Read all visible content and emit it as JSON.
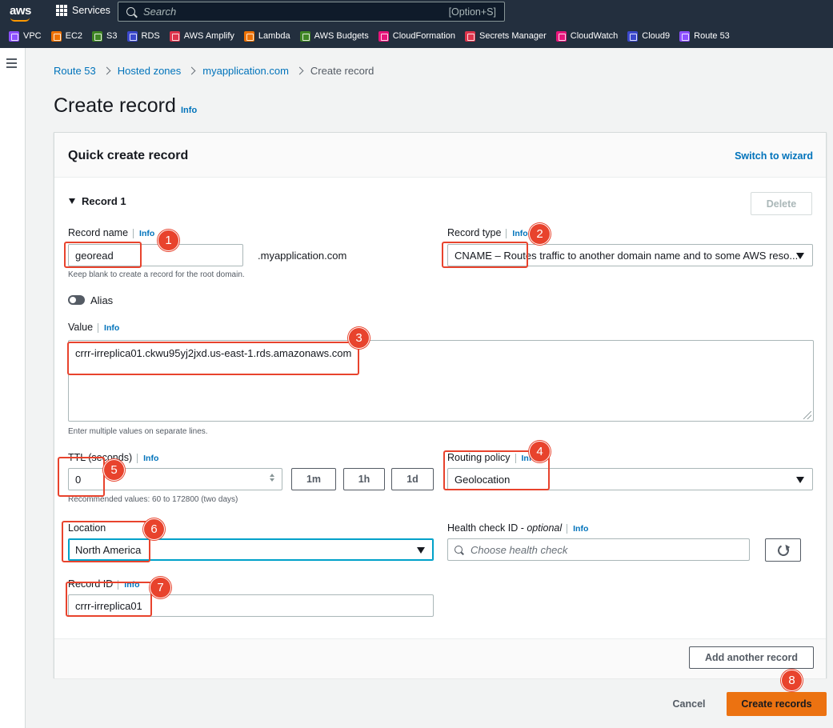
{
  "topnav": {
    "logo": "aws",
    "services_label": "Services",
    "search_placeholder": "Search",
    "search_shortcut": "[Option+S]",
    "favorites": [
      {
        "label": "VPC",
        "color": "#8c4fff"
      },
      {
        "label": "EC2",
        "color": "#ed7100"
      },
      {
        "label": "S3",
        "color": "#3f8624"
      },
      {
        "label": "RDS",
        "color": "#3b48cc"
      },
      {
        "label": "AWS Amplify",
        "color": "#dd344c"
      },
      {
        "label": "Lambda",
        "color": "#ed7100"
      },
      {
        "label": "AWS Budgets",
        "color": "#3f8624"
      },
      {
        "label": "CloudFormation",
        "color": "#e7157b"
      },
      {
        "label": "Secrets Manager",
        "color": "#dd344c"
      },
      {
        "label": "CloudWatch",
        "color": "#e7157b"
      },
      {
        "label": "Cloud9",
        "color": "#3b48cc"
      },
      {
        "label": "Route 53",
        "color": "#8c4fff"
      }
    ]
  },
  "breadcrumb": [
    "Route 53",
    "Hosted zones",
    "myapplication.com",
    "Create record"
  ],
  "page": {
    "title": "Create record",
    "info": "Info"
  },
  "panel": {
    "title": "Quick create record",
    "switch_wizard": "Switch to wizard",
    "record_heading": "Record 1",
    "delete_label": "Delete"
  },
  "form": {
    "record_name": {
      "label": "Record name",
      "info": "Info",
      "value": "georead",
      "suffix": ".myapplication.com",
      "hint": "Keep blank to create a record for the root domain."
    },
    "record_type": {
      "label": "Record type",
      "info": "Info",
      "value": "CNAME – Routes traffic to another domain name and to some AWS reso..."
    },
    "alias": {
      "label": "Alias"
    },
    "value": {
      "label": "Value",
      "info": "Info",
      "text": "crrr-irreplica01.ckwu95yj2jxd.us-east-1.rds.amazonaws.com",
      "hint": "Enter multiple values on separate lines."
    },
    "ttl": {
      "label": "TTL (seconds)",
      "info": "Info",
      "value": "0",
      "presets": [
        "1m",
        "1h",
        "1d"
      ],
      "hint": "Recommended values: 60 to 172800 (two days)"
    },
    "routing_policy": {
      "label": "Routing policy",
      "info": "Info",
      "value": "Geolocation"
    },
    "location": {
      "label": "Location",
      "value": "North America"
    },
    "health_check": {
      "label_main": "Health check ID - ",
      "label_optional": "optional",
      "info": "Info",
      "placeholder": "Choose health check"
    },
    "record_id": {
      "label": "Record ID",
      "info": "Info",
      "value": "crrr-irreplica01"
    }
  },
  "actions": {
    "add_another": "Add another record",
    "cancel": "Cancel",
    "create": "Create records"
  },
  "annotations": [
    "1",
    "2",
    "3",
    "4",
    "5",
    "6",
    "7",
    "8"
  ],
  "colors": {
    "nav_bg": "#232f3e",
    "link": "#0073bb",
    "primary": "#ec7211",
    "annotation": "#e8432d",
    "focus": "#00a1c9"
  }
}
